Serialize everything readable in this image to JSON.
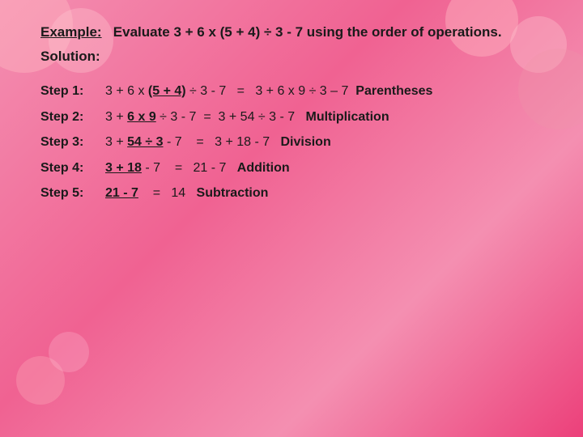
{
  "background": {
    "color": "#f48fb1"
  },
  "example": {
    "label": "Example:",
    "text": "Evaluate 3 + 6 x (5 + 4) ÷ 3 - 7 using the order of operations."
  },
  "solution": {
    "label": "Solution:"
  },
  "steps": [
    {
      "label": "Step 1:",
      "equation_left": "3 + 6 x ",
      "highlight": "(5 + 4)",
      "equation_right": " ÷ 3 - 7",
      "equals": "=",
      "result": "3 + 6 x 9 ÷ 3 – 7",
      "keyword": "Parentheses"
    },
    {
      "label": "Step 2:",
      "equation_left": "3 + ",
      "highlight": "6 x 9",
      "equation_right": " ÷ 3 - 7",
      "equals": "=",
      "result": "3 + 54 ÷ 3 - 7",
      "keyword": "Multiplication"
    },
    {
      "label": "Step 3:",
      "equation_left": "3 + ",
      "highlight": "54 ÷ 3",
      "equation_right": " - 7",
      "equals": "=",
      "result": "3 + 18 - 7",
      "keyword": "Division"
    },
    {
      "label": "Step 4:",
      "equation_left": "",
      "highlight": "3 + 18",
      "equation_right": " - 7",
      "equals": "=",
      "result": "21 - 7",
      "keyword": "Addition"
    },
    {
      "label": "Step 5:",
      "equation_left": "",
      "highlight": "21 - 7",
      "equation_right": "",
      "equals": "=",
      "result": "14",
      "keyword": "Subtraction"
    }
  ]
}
